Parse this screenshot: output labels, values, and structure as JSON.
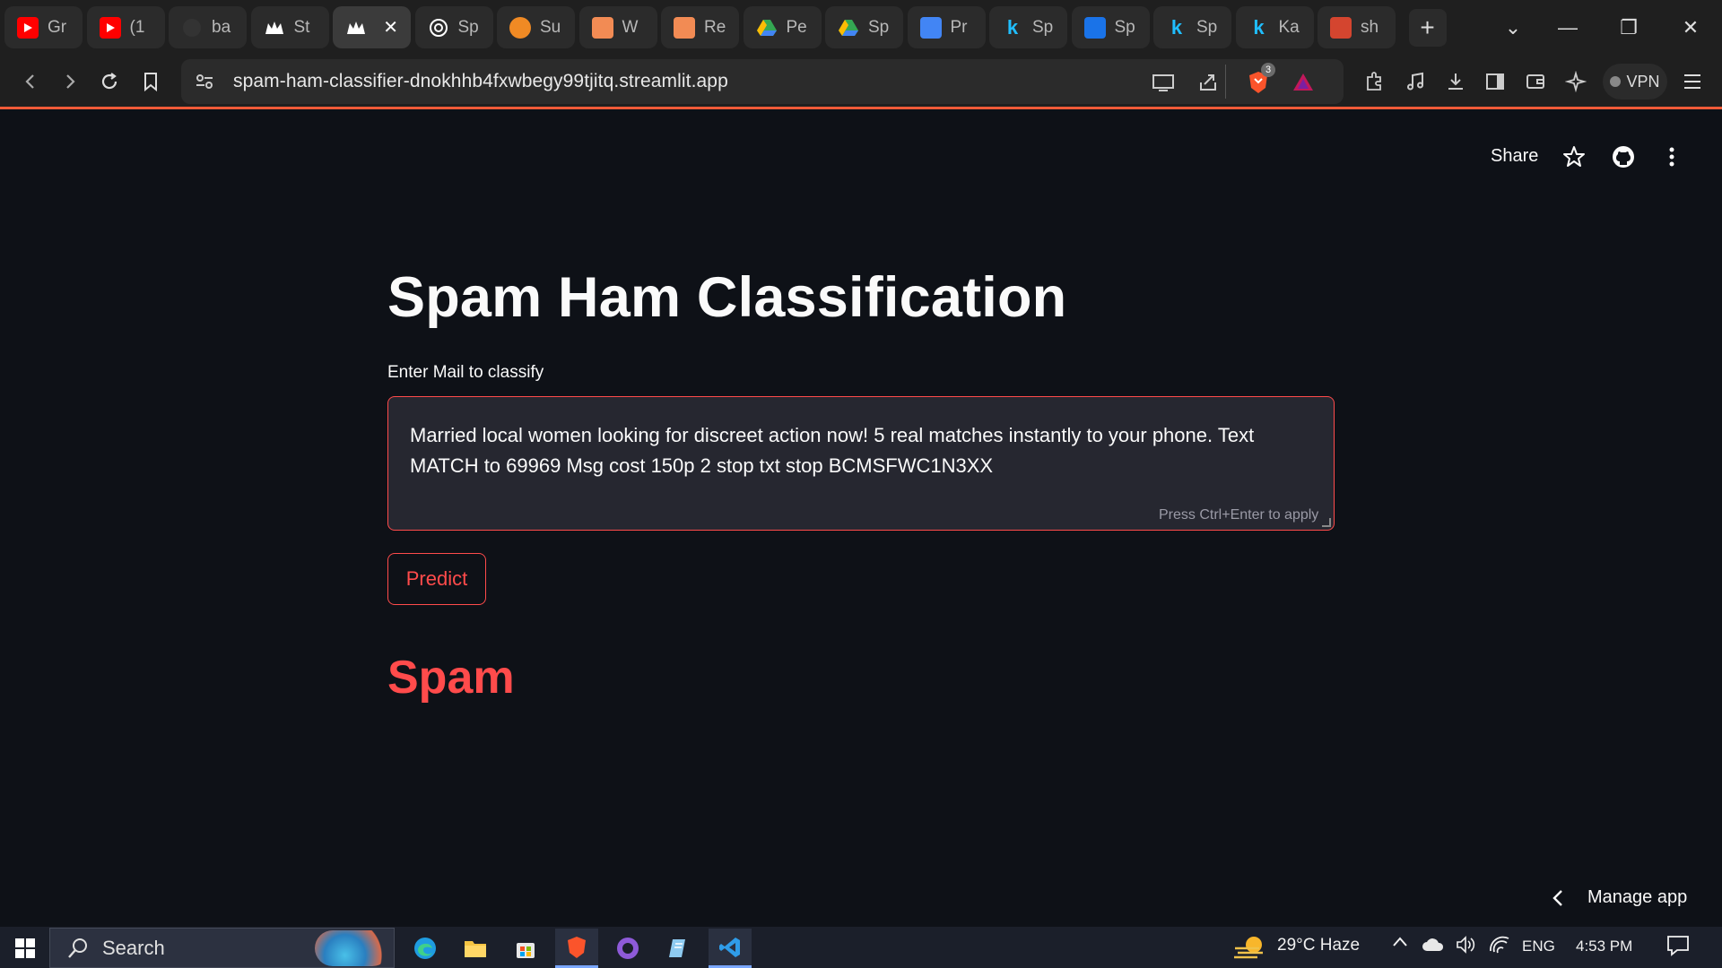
{
  "browser": {
    "tabs": [
      {
        "label": "Gr",
        "icon": "youtube-icon",
        "color": "#ff0000"
      },
      {
        "label": "(1",
        "icon": "youtube-icon",
        "color": "#ff0000"
      },
      {
        "label": "ba",
        "icon": "github-icon",
        "color": "#222222"
      },
      {
        "label": "St",
        "icon": "streamlit-icon",
        "color": "#ffffff"
      },
      {
        "label": "",
        "icon": "streamlit-icon",
        "color": "#ffffff",
        "active": true
      },
      {
        "label": "Sp",
        "icon": "openai-icon",
        "color": "#ffffff"
      },
      {
        "label": "Su",
        "icon": "orange-circle-icon",
        "color": "#f08a24"
      },
      {
        "label": "W",
        "icon": "window-icon",
        "color": "#f28b54"
      },
      {
        "label": "Re",
        "icon": "window-icon",
        "color": "#f28b54"
      },
      {
        "label": "Pe",
        "icon": "google-drive-icon",
        "color": "#34a853"
      },
      {
        "label": "Sp",
        "icon": "google-drive-icon",
        "color": "#34a853"
      },
      {
        "label": "Pr",
        "icon": "google-docs-icon",
        "color": "#4285f4"
      },
      {
        "label": "Sp",
        "icon": "kaggle-icon",
        "color": "#20beff"
      },
      {
        "label": "Sp",
        "icon": "database-icon",
        "color": "#1a73e8"
      },
      {
        "label": "Sp",
        "icon": "kaggle-icon",
        "color": "#20beff"
      },
      {
        "label": "Ka",
        "icon": "kaggle-icon",
        "color": "#20beff"
      },
      {
        "label": "sh",
        "icon": "brave-talk-icon",
        "color": "#d4452f"
      }
    ],
    "url": "spam-ham-classifier-dnokhhb4fxwbegy99tjitq.streamlit.app",
    "brave_badge": "3",
    "vpn_label": "VPN",
    "accent": "#f05a38"
  },
  "app": {
    "header": {
      "share_label": "Share"
    },
    "title": "Spam Ham Classification",
    "input_label": "Enter Mail to classify",
    "input_value": "Married local women looking for discreet action now! 5 real matches instantly to your phone. Text MATCH to 69969 Msg cost 150p 2 stop txt stop BCMSFWC1N3XX",
    "input_hint": "Press Ctrl+Enter to apply",
    "predict_label": "Predict",
    "result": "Spam",
    "manage_label": "Manage app",
    "accent": "#ff4b4b"
  },
  "taskbar": {
    "search_label": "Search",
    "weather": "29°C  Haze",
    "language": "ENG",
    "time": "4:53 PM"
  }
}
